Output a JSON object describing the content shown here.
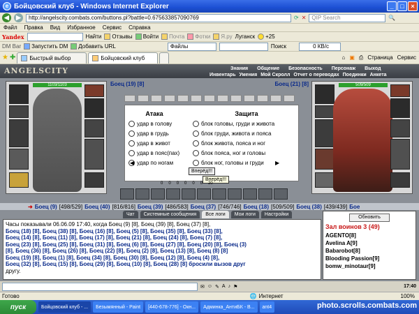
{
  "window": {
    "title": "Бойцовский клуб - Windows Internet Explorer",
    "address": "http://angelscity.combats.com/buttons.pl?battle=0.675633857090769",
    "search_placeholder": "QIP Search"
  },
  "menu": [
    "Файл",
    "Правка",
    "Вид",
    "Избранное",
    "Сервис",
    "Справка"
  ],
  "ytoolbar": {
    "yandex": "Yandex",
    "find": "Найти",
    "reviews": "Отзывы",
    "login": "Войти",
    "mail": "Почта",
    "photo": "Фотки",
    "ya": "Я.ру",
    "lugansk": "Луганск",
    "temp": "+25"
  },
  "dmbar": {
    "label": "DM Bar",
    "launch": "Запустить DM",
    "add": "Добавить URL",
    "files": "Файлы",
    "search": "Поиск",
    "kbd": "0 КВ/с"
  },
  "tabs": [
    {
      "label": "Быстрый выбор"
    },
    {
      "label": "Бойцовский клуб"
    }
  ],
  "tabtools": {
    "page": "Страница",
    "service": "Сервис"
  },
  "game": {
    "logo": "ANGELSCITY",
    "nav_top": [
      "Знания",
      "Общение",
      "Безопасность",
      "Персонаж",
      "Выход"
    ],
    "nav_bottom": [
      "Инвентарь",
      "Умения",
      "Мой Скролл",
      "Отчет о переводах",
      "Поединки",
      "Анкета"
    ],
    "left_hp": "1103/1103",
    "right_hp": "509/509",
    "left_fighter": "Боец (19) [8]",
    "right_fighter": "Боец (21) [8]",
    "attack_title": "Атака",
    "defense_title": "Защита",
    "attacks": [
      "удар в голову",
      "удар в грудь",
      "удар в живот",
      "удар в пояс(пах)",
      "удар по ногам"
    ],
    "defenses": [
      "блок головы, груди и живота",
      "блок груди, живота и пояса",
      "блок живота, пояса и ног",
      "блок пояса, ног и головы",
      "блок ног, головы и груди"
    ],
    "forward": "Вперёд!!!",
    "forward_tip": "Вперёд!!!",
    "counters": [
      "0",
      "0",
      "0",
      "0",
      "0",
      "0",
      "20"
    ],
    "fighters_row": [
      {
        "n": "Боец (9)",
        "s": "[498/529]"
      },
      {
        "n": "Боец (40)",
        "s": "[816/816]"
      },
      {
        "n": "Боец (39)",
        "s": "[486/583]"
      },
      {
        "n": "Боец (37)",
        "s": "[746/746]"
      },
      {
        "n": "Боец (18)",
        "s": "[509/509]"
      },
      {
        "n": "Боец (38)",
        "s": "[439/439]"
      },
      {
        "n": "Бое",
        "s": ""
      }
    ],
    "chat_tabs": [
      "Чат",
      "Системные сообщения",
      "Все логи",
      "Мои логи",
      "Настройки"
    ],
    "chat_lines": [
      "Часы показывали 06.06.09 17:40, когда Боец (9) [8], Боец (39) [8], Боец (37) [8],",
      "Боец (18) [8], Боец (38) [8], Боец (16) [8], Боец (5) [8], Боец (35) [8], Боец (33) [8],",
      "Боец (14) [8], Боец (11) [8], Боец (17) [8], Боец (21) [8], Боец (24) [8], Боец (7) [8],",
      "Боец (23) [8], Боец (25) [8], Боец (31) [8], Боец (6) [8], Боец (27) [8], Боец (20) [8], Боец (3)",
      "[8], Боец (36) [8], Боец (26) [8], Боец (22) [8], Боец (2) [8], Боец (13) [8], Боец (8) [8]",
      "Боец (19) [8], Боец (1) [8], Боец (34) [8], Боец (30) [8], Боец (12) [8], Боец (4) [8],",
      "Боец (32) [8], Боец (15) [8], Боец (29) [8], Боец (10) [8], Боец (28) [8] бросили вызов друг",
      "другу."
    ],
    "refresh": "Обновить",
    "room_title": "Зал воинов 3 (49)",
    "players": [
      "AGENTO[8]",
      "Avelina A[9]",
      "Babarobot[8]",
      "Blooding Passion[9]",
      "bomw_minotaur[9]"
    ]
  },
  "status": {
    "left": "Готово",
    "zone": "Интернет",
    "zoom": "100%"
  },
  "taskbar": {
    "start": "пуск",
    "items": [
      "Бойцовский клуб - ...",
      "Безымянный - Paint",
      "[440-678-776] - Окн...",
      "Админка_АнтиБК - В...",
      "ant4"
    ]
  },
  "watermark": "photo.scrolls.combats.com",
  "clock": "17:40"
}
